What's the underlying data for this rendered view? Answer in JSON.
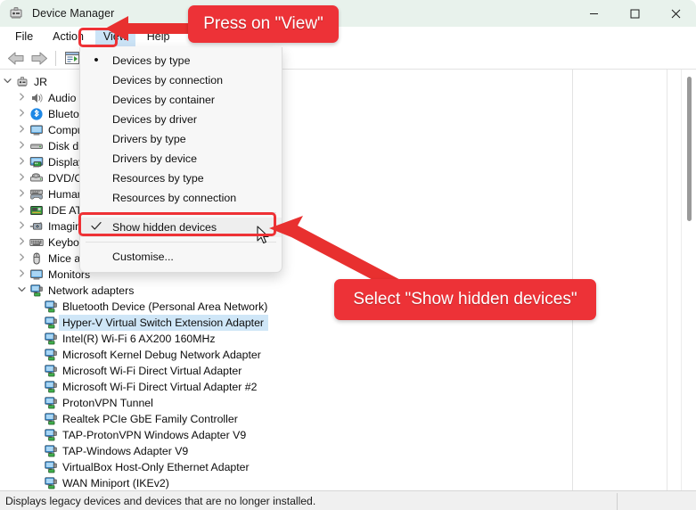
{
  "window": {
    "title": "Device Manager",
    "icon": "device-manager-icon",
    "minimize_label": "─",
    "maximize_label": "☐",
    "close_label": "✕"
  },
  "menubar": {
    "items": [
      {
        "label": "File",
        "active": false
      },
      {
        "label": "Action",
        "active": false
      },
      {
        "label": "View",
        "active": true
      },
      {
        "label": "Help",
        "active": false
      }
    ]
  },
  "toolbar": {
    "items": [
      {
        "name": "back-icon",
        "glyph": "⬅"
      },
      {
        "name": "forward-icon",
        "glyph": "➡"
      },
      {
        "name": "properties-icon",
        "glyph": "▤"
      }
    ]
  },
  "view_menu": {
    "items": [
      {
        "label": "Devices by type",
        "mark": "bullet",
        "separator_after": false
      },
      {
        "label": "Devices by connection",
        "mark": "",
        "separator_after": false
      },
      {
        "label": "Devices by container",
        "mark": "",
        "separator_after": false
      },
      {
        "label": "Devices by driver",
        "mark": "",
        "separator_after": false
      },
      {
        "label": "Drivers by type",
        "mark": "",
        "separator_after": false
      },
      {
        "label": "Drivers by device",
        "mark": "",
        "separator_after": false
      },
      {
        "label": "Resources by type",
        "mark": "",
        "separator_after": false
      },
      {
        "label": "Resources by connection",
        "mark": "",
        "separator_after": true
      },
      {
        "label": "Show hidden devices",
        "mark": "check",
        "separator_after": true,
        "highlighted": true
      },
      {
        "label": "Customise...",
        "mark": "",
        "separator_after": false
      }
    ]
  },
  "tree": {
    "nodes": [
      {
        "label": "JR",
        "indent": 0,
        "chev": "down",
        "icon": "computer-icon",
        "selected": false
      },
      {
        "label": "Audio inputs and outputs",
        "indent": 1,
        "chev": "right",
        "icon": "speaker-icon",
        "selected": false
      },
      {
        "label": "Bluetooth",
        "indent": 1,
        "chev": "right",
        "icon": "bluetooth-icon",
        "selected": false
      },
      {
        "label": "Computer",
        "indent": 1,
        "chev": "right",
        "icon": "monitor-icon",
        "selected": false
      },
      {
        "label": "Disk drives",
        "indent": 1,
        "chev": "right",
        "icon": "disk-icon",
        "selected": false
      },
      {
        "label": "Display adapters",
        "indent": 1,
        "chev": "right",
        "icon": "display-icon",
        "selected": false
      },
      {
        "label": "DVD/CD-ROM drives",
        "indent": 1,
        "chev": "right",
        "icon": "dvd-icon",
        "selected": false
      },
      {
        "label": "Human Interface Devices",
        "indent": 1,
        "chev": "right",
        "icon": "hid-icon",
        "selected": false
      },
      {
        "label": "IDE ATA/ATAPI controllers",
        "indent": 1,
        "chev": "right",
        "icon": "ide-icon",
        "selected": false
      },
      {
        "label": "Imaging devices",
        "indent": 1,
        "chev": "right",
        "icon": "camera-icon",
        "selected": false
      },
      {
        "label": "Keyboards",
        "indent": 1,
        "chev": "right",
        "icon": "keyboard-icon",
        "selected": false
      },
      {
        "label": "Mice and other pointing devices",
        "indent": 1,
        "chev": "right",
        "icon": "mouse-icon",
        "selected": false
      },
      {
        "label": "Monitors",
        "indent": 1,
        "chev": "right",
        "icon": "monitor-icon",
        "selected": false
      },
      {
        "label": "Network adapters",
        "indent": 1,
        "chev": "down",
        "icon": "network-icon",
        "selected": false
      },
      {
        "label": "Bluetooth Device (Personal Area Network)",
        "indent": 2,
        "chev": "",
        "icon": "network-icon",
        "selected": false
      },
      {
        "label": "Hyper-V Virtual Switch Extension Adapter",
        "indent": 2,
        "chev": "",
        "icon": "network-icon",
        "selected": true
      },
      {
        "label": "Intel(R) Wi-Fi 6 AX200 160MHz",
        "indent": 2,
        "chev": "",
        "icon": "network-icon",
        "selected": false
      },
      {
        "label": "Microsoft Kernel Debug Network Adapter",
        "indent": 2,
        "chev": "",
        "icon": "network-icon",
        "selected": false
      },
      {
        "label": "Microsoft Wi-Fi Direct Virtual Adapter",
        "indent": 2,
        "chev": "",
        "icon": "network-icon",
        "selected": false
      },
      {
        "label": "Microsoft Wi-Fi Direct Virtual Adapter #2",
        "indent": 2,
        "chev": "",
        "icon": "network-icon",
        "selected": false
      },
      {
        "label": "ProtonVPN Tunnel",
        "indent": 2,
        "chev": "",
        "icon": "network-icon",
        "selected": false
      },
      {
        "label": "Realtek PCIe GbE Family Controller",
        "indent": 2,
        "chev": "",
        "icon": "network-icon",
        "selected": false
      },
      {
        "label": "TAP-ProtonVPN Windows Adapter V9",
        "indent": 2,
        "chev": "",
        "icon": "network-icon",
        "selected": false
      },
      {
        "label": "TAP-Windows Adapter V9",
        "indent": 2,
        "chev": "",
        "icon": "network-icon",
        "selected": false
      },
      {
        "label": "VirtualBox Host-Only Ethernet Adapter",
        "indent": 2,
        "chev": "",
        "icon": "network-icon",
        "selected": false
      },
      {
        "label": "WAN Miniport (IKEv2)",
        "indent": 2,
        "chev": "",
        "icon": "network-icon",
        "selected": false
      }
    ]
  },
  "statusbar": {
    "text": "Displays legacy devices and devices that are no longer installed."
  },
  "annotations": {
    "accent_color": "#ed3237",
    "callout_1": "Press on \"View\"",
    "callout_2": "Select \"Show hidden devices\""
  }
}
